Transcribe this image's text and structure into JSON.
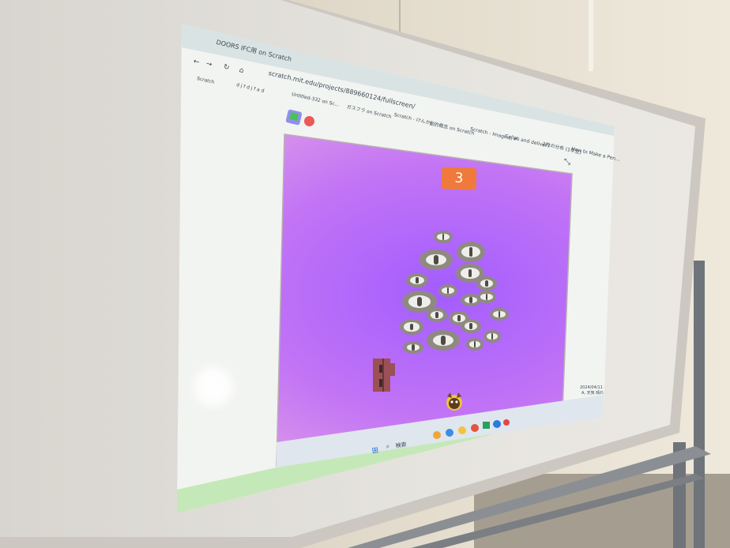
{
  "browser": {
    "tab_title": "DOORS  IFC用  on Scratch",
    "address": "scratch.mit.edu/projects/889660124/fullscreen/",
    "bookmarks": [
      "Scratch",
      "d j f d j f a d",
      "Untitled-332 on Sc...",
      "ガスフラ on Scratch",
      "Scratch - けんか",
      "動的概念 on Scratch",
      "Scratch - Imagine, P",
      "Collab and deliver i",
      "2枚の分布 (1年生)",
      "How to Make a Pen..."
    ]
  },
  "stage": {
    "score": "3"
  },
  "taskbar": {
    "search_label": "検索",
    "time": "2024/04/11",
    "date": "A, 天気 晴れ"
  },
  "colors": {
    "stage_center": "#a35dff",
    "score_bg": "#f07a3c",
    "flag": "#4cbf56",
    "stop": "#ec5959",
    "eye_rim": "#8f8a80"
  },
  "icons": [
    "back-arrow-icon",
    "forward-arrow-icon",
    "reload-icon",
    "home-icon",
    "green-flag-icon",
    "stop-sign-icon",
    "fullscreen-icon",
    "windows-start-icon",
    "search-icon"
  ]
}
